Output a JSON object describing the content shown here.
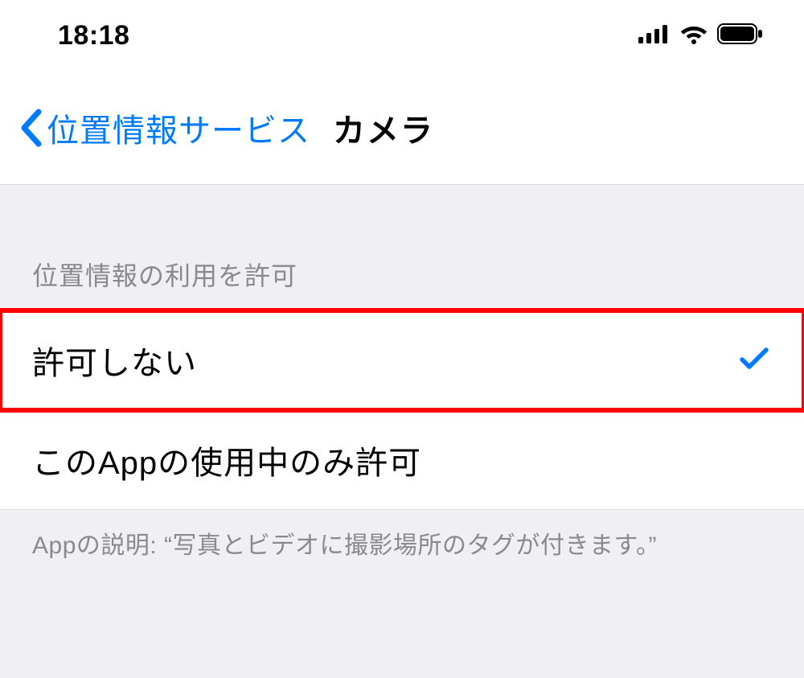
{
  "statusbar": {
    "time": "18:18"
  },
  "nav": {
    "back": "位置情報サービス",
    "title": "カメラ"
  },
  "section": {
    "header": "位置情報の利用を許可"
  },
  "options": [
    {
      "label": "許可しない",
      "selected": true,
      "highlighted": true
    },
    {
      "label": "このAppの使用中のみ許可",
      "selected": false,
      "highlighted": false
    }
  ],
  "footer": "Appの説明: “写真とビデオに撮影場所のタグが付きます。”"
}
